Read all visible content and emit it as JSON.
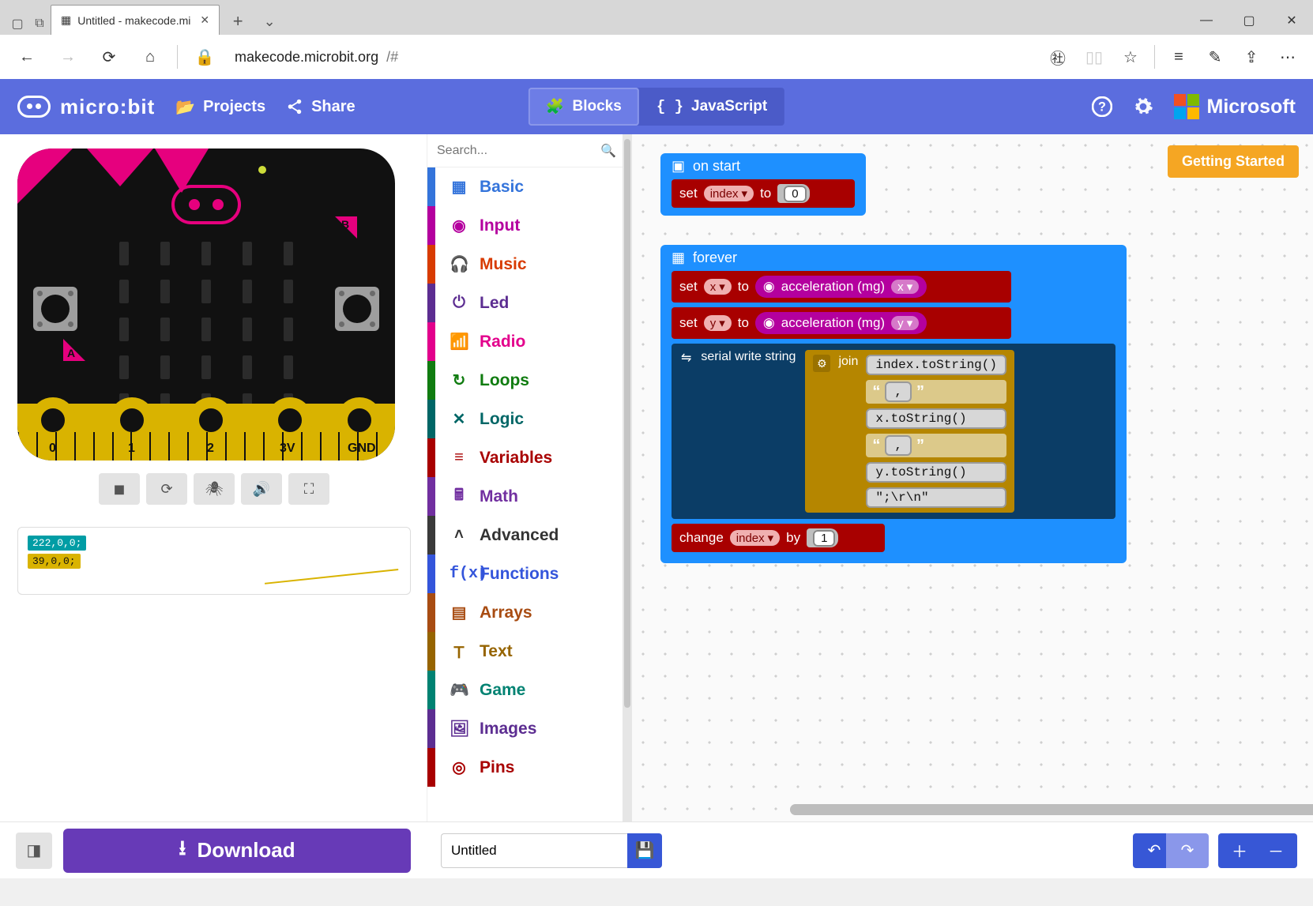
{
  "browser": {
    "tab_title": "Untitled - makecode.mi",
    "url_host": "makecode.microbit.org",
    "url_path": "/#"
  },
  "header": {
    "logo_text": "micro:bit",
    "projects": "Projects",
    "share": "Share",
    "mode_blocks": "Blocks",
    "mode_js": "JavaScript",
    "microsoft": "Microsoft"
  },
  "toolbox": {
    "search_placeholder": "Search...",
    "categories": {
      "basic": "Basic",
      "input": "Input",
      "music": "Music",
      "led": "Led",
      "radio": "Radio",
      "loops": "Loops",
      "logic": "Logic",
      "variables": "Variables",
      "math": "Math",
      "advanced": "Advanced",
      "functions": "Functions",
      "arrays": "Arrays",
      "text": "Text",
      "game": "Game",
      "images": "Images",
      "pins": "Pins"
    }
  },
  "board": {
    "pin0": "0",
    "pin1": "1",
    "pin2": "2",
    "pin3v": "3V",
    "pingnd": "GND",
    "btnA": "A",
    "btnB": "B"
  },
  "serial_out": {
    "line1": "222,0,0;",
    "line2": "39,0,0;"
  },
  "canvas": {
    "getting_started": "Getting Started",
    "on_start": "on start",
    "forever": "forever",
    "set": "set",
    "to": "to",
    "change": "change",
    "by": "by",
    "var_index": "index",
    "var_x": "x",
    "var_y": "y",
    "val0": "0",
    "val1": "1",
    "accel": "acceleration (mg)",
    "serial_write": "serial write string",
    "join": "join",
    "j1": "index.toString()",
    "j2": ",",
    "j3": "x.toString()",
    "j4": ",",
    "j5": "y.toString()",
    "j6": "\";\\r\\n\""
  },
  "footer": {
    "download": "Download",
    "project_name": "Untitled"
  }
}
